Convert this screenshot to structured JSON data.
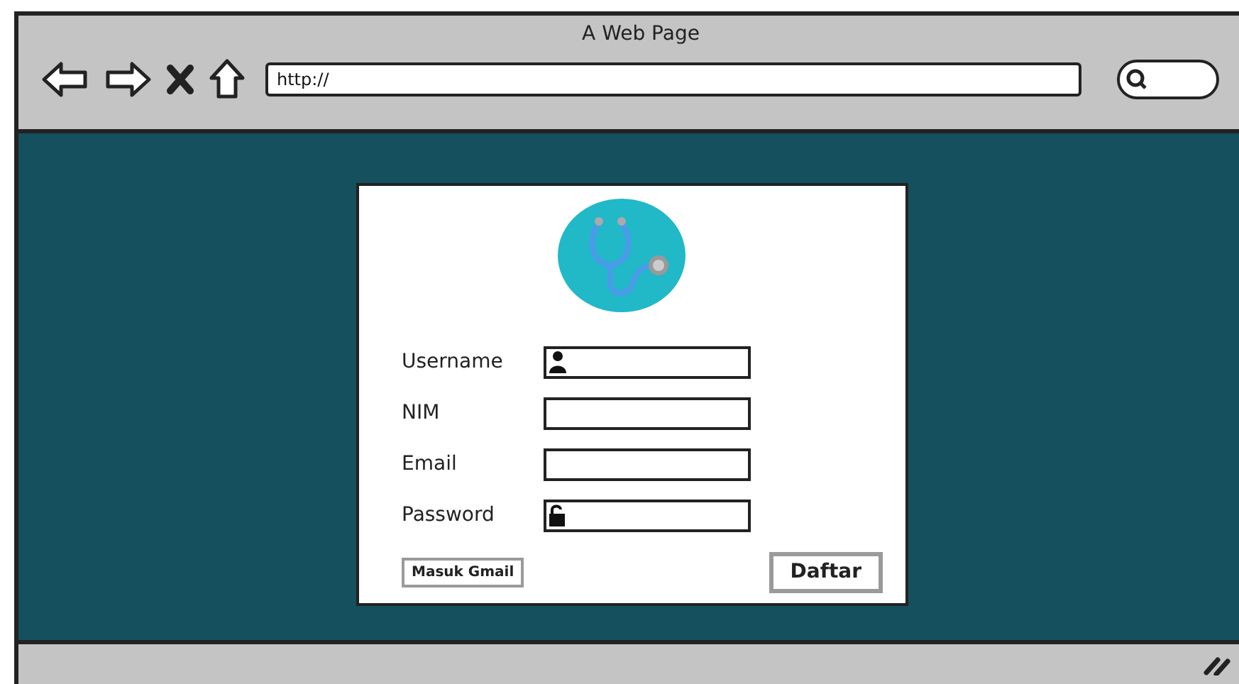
{
  "window": {
    "title": "A Web Page"
  },
  "address_bar": {
    "value": "http://"
  },
  "form": {
    "fields": [
      {
        "label": "Username",
        "kind": "user"
      },
      {
        "label": "NIM",
        "kind": "plain"
      },
      {
        "label": "Email",
        "kind": "plain"
      },
      {
        "label": "Password",
        "kind": "lock"
      }
    ],
    "buttons": [
      {
        "label": "Masuk Gmail",
        "kind": "small"
      },
      {
        "label": "Daftar",
        "kind": "large"
      }
    ]
  }
}
